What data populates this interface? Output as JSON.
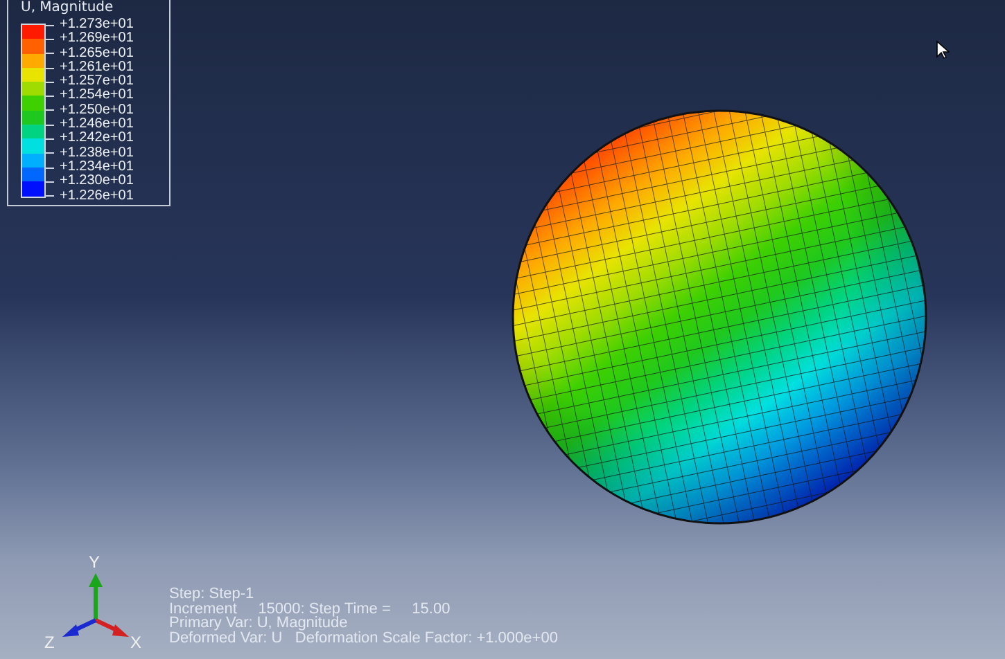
{
  "legend": {
    "title": "U, Magnitude",
    "bands": [
      {
        "color": "#ff1a00"
      },
      {
        "color": "#ff6000"
      },
      {
        "color": "#ffaa00"
      },
      {
        "color": "#e8e400"
      },
      {
        "color": "#a0dc00"
      },
      {
        "color": "#3ed000"
      },
      {
        "color": "#1ec81e"
      },
      {
        "color": "#00d482"
      },
      {
        "color": "#00e0e0"
      },
      {
        "color": "#00b0ff"
      },
      {
        "color": "#0068ff"
      },
      {
        "color": "#0010ff"
      }
    ],
    "labels": [
      "+1.273e+01",
      "+1.269e+01",
      "+1.265e+01",
      "+1.261e+01",
      "+1.257e+01",
      "+1.254e+01",
      "+1.250e+01",
      "+1.246e+01",
      "+1.242e+01",
      "+1.238e+01",
      "+1.234e+01",
      "+1.230e+01",
      "+1.226e+01"
    ]
  },
  "triad": {
    "y": "Y",
    "z": "Z",
    "x": "X"
  },
  "info": [
    "Step: Step-1",
    "Increment     15000: Step Time =     15.00",
    "Primary Var: U, Magnitude",
    "Deformed Var: U   Deformation Scale Factor: +1.000e+00"
  ]
}
